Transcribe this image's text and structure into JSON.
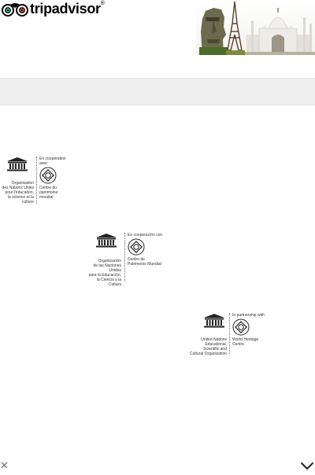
{
  "header": {
    "brand_text": "tripadvisor",
    "brand_reg": "®",
    "logo_icon": "owl-eyes-icon",
    "banner_image": "landmarks-collage"
  },
  "logos": [
    {
      "language": "fr",
      "partner_line": "En coopération avec",
      "org_lines": [
        "Organisation",
        "des Nations Unies",
        "pour l'éducation,",
        "la science et la culture"
      ],
      "centre_lines": [
        "Centre du",
        "patrimoine mondial"
      ]
    },
    {
      "language": "es",
      "partner_line": "En cooperación con",
      "org_lines": [
        "Organización",
        "de las Naciones Unidas",
        "para la Educación,",
        "la Ciencia y la Cultura"
      ],
      "centre_lines": [
        "Centro de",
        "Patrimonio Mundial"
      ]
    },
    {
      "language": "en",
      "partner_line": "In partnership with",
      "org_lines": [
        "United Nations",
        "Educational, Scientific and",
        "Cultural Organization"
      ],
      "centre_lines": [
        "World Heritage",
        "Centre"
      ]
    }
  ],
  "footer": {
    "close_icon": "close-icon",
    "chevron_icon": "chevron-down-icon"
  }
}
